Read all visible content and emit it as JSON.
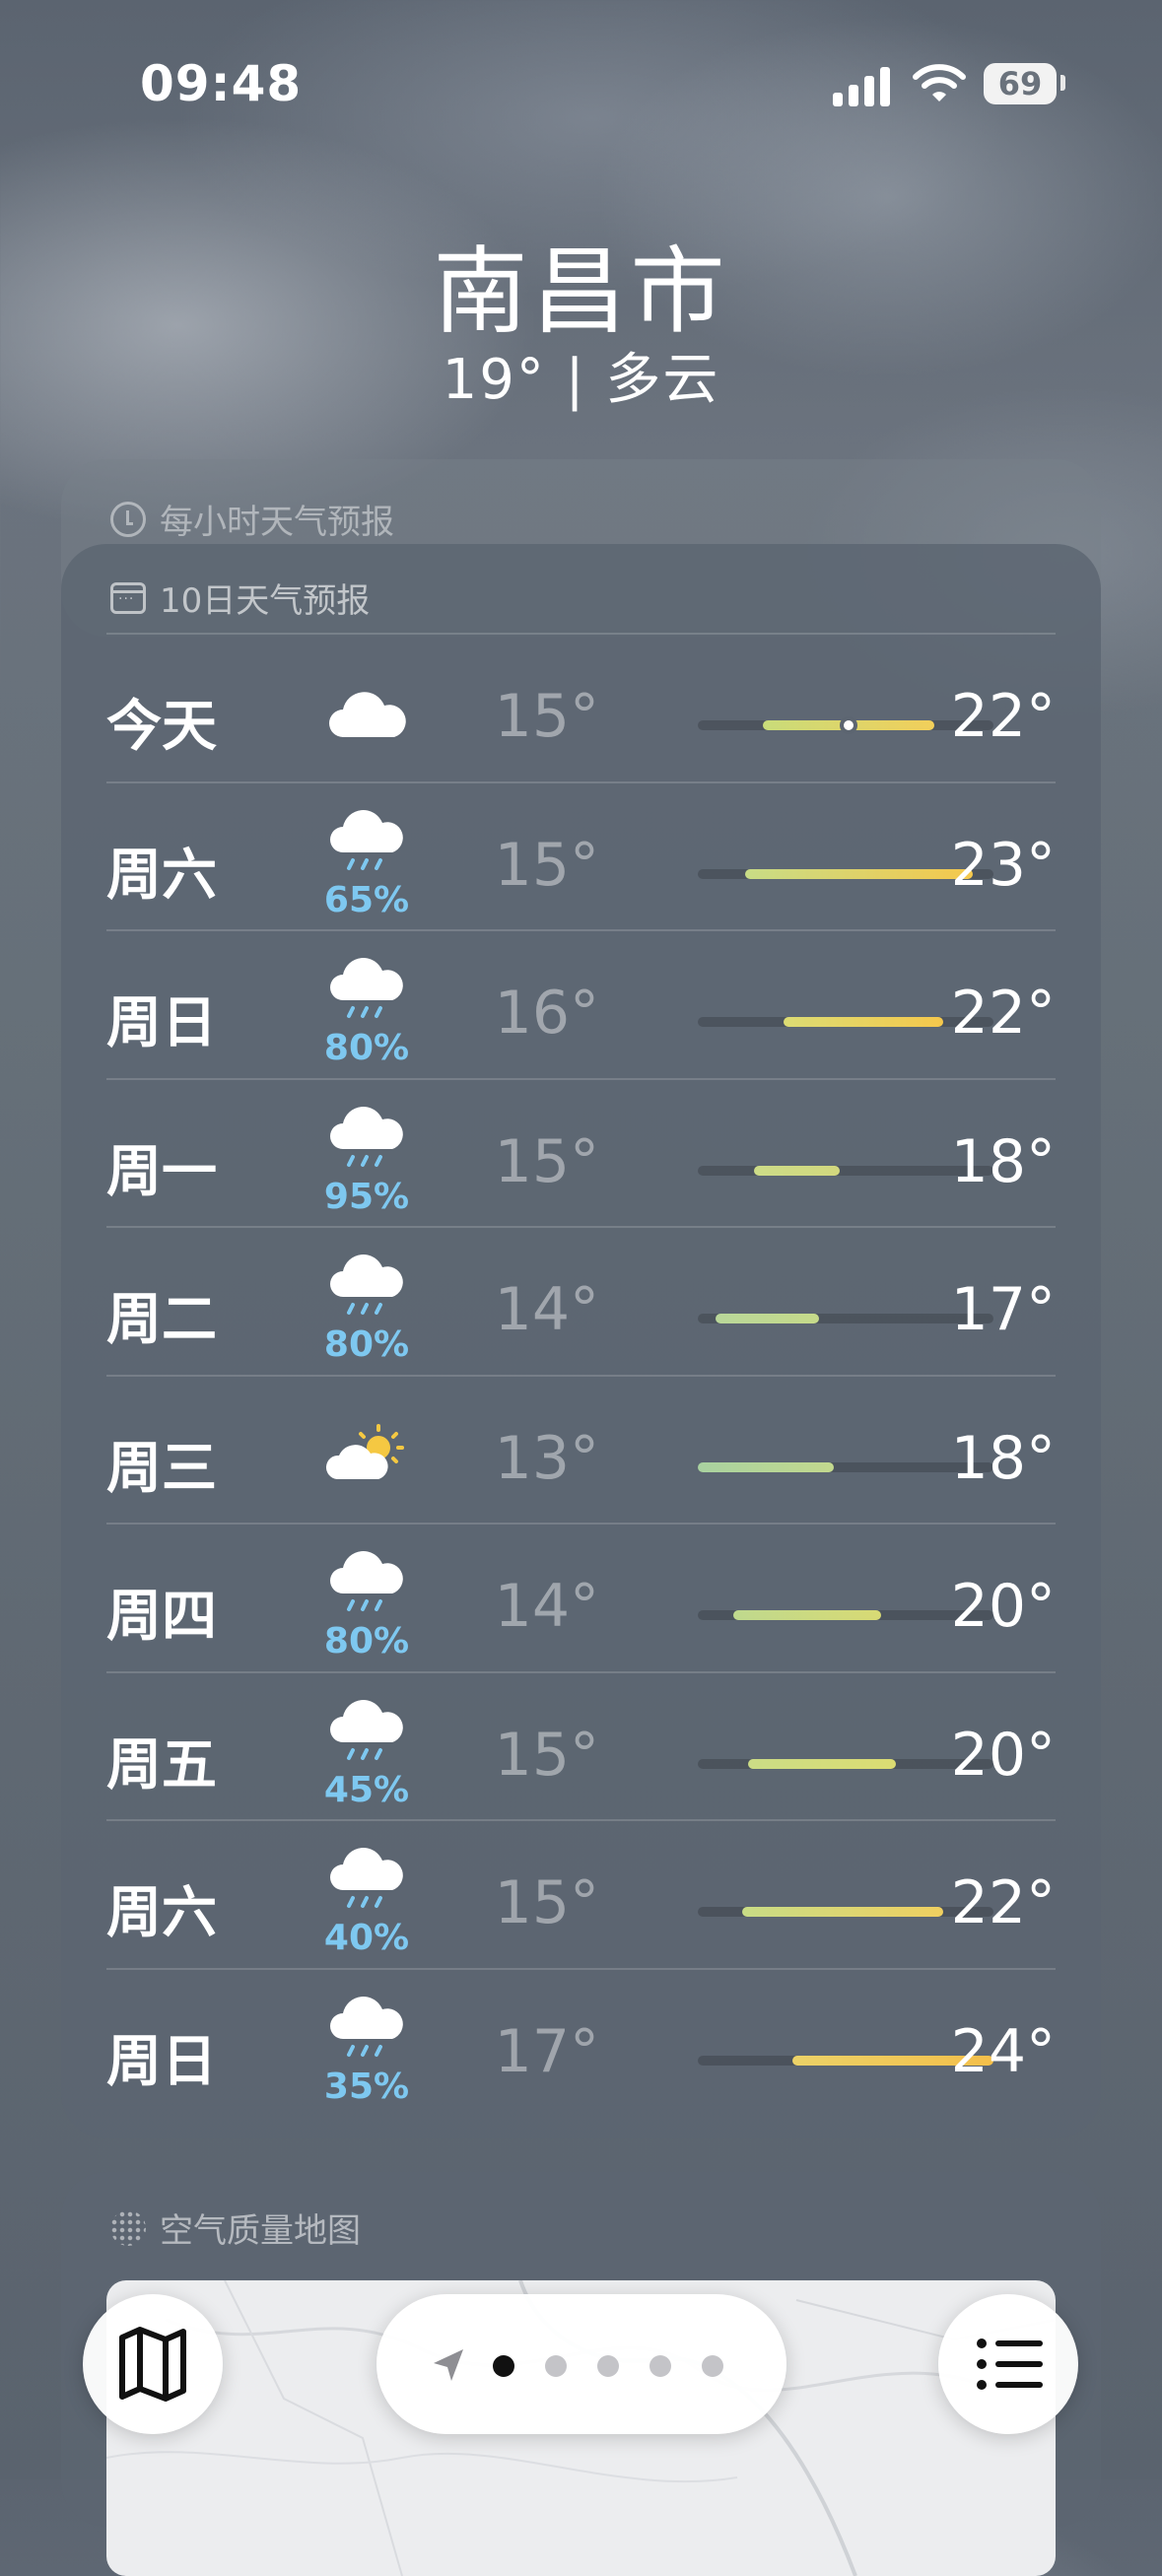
{
  "status_bar": {
    "time": "09:48",
    "battery": "69"
  },
  "location": {
    "city": "南昌市",
    "summary": "19° | 多云"
  },
  "hourly_card": {
    "title": "每小时天气预报"
  },
  "forecast_card": {
    "title": "10日天气预报",
    "days": [
      {
        "day": "今天",
        "icon": "cloud-icon",
        "precip": "",
        "low": "15°",
        "high": "22°",
        "bar_start": 0.22,
        "bar_end": 0.8,
        "current": 0.51,
        "color_from": "#c9dc7a",
        "color_to": "#f2cf5a"
      },
      {
        "day": "周六",
        "icon": "cloud-rain-icon",
        "precip": "65%",
        "low": "15°",
        "high": "23°",
        "bar_start": 0.16,
        "bar_end": 0.93,
        "current": null,
        "color_from": "#c8dc86",
        "color_to": "#f5c84c"
      },
      {
        "day": "周日",
        "icon": "cloud-rain-icon",
        "precip": "80%",
        "low": "16°",
        "high": "22°",
        "bar_start": 0.29,
        "bar_end": 0.83,
        "current": null,
        "color_from": "#dcdc74",
        "color_to": "#f5c84c"
      },
      {
        "day": "周一",
        "icon": "cloud-rain-icon",
        "precip": "95%",
        "low": "15°",
        "high": "18°",
        "bar_start": 0.19,
        "bar_end": 0.48,
        "current": null,
        "color_from": "#cddc88",
        "color_to": "#d2d87e"
      },
      {
        "day": "周二",
        "icon": "cloud-rain-icon",
        "precip": "80%",
        "low": "14°",
        "high": "17°",
        "bar_start": 0.06,
        "bar_end": 0.41,
        "current": null,
        "color_from": "#b9d79a",
        "color_to": "#c6da8a"
      },
      {
        "day": "周三",
        "icon": "sun-cloud-icon",
        "precip": "",
        "low": "13°",
        "high": "18°",
        "bar_start": 0.0,
        "bar_end": 0.46,
        "current": null,
        "color_from": "#a9d2a0",
        "color_to": "#c3d98e"
      },
      {
        "day": "周四",
        "icon": "cloud-rain-icon",
        "precip": "80%",
        "low": "14°",
        "high": "20°",
        "bar_start": 0.12,
        "bar_end": 0.62,
        "current": null,
        "color_from": "#bfd98e",
        "color_to": "#d8da74"
      },
      {
        "day": "周五",
        "icon": "cloud-rain-icon",
        "precip": "45%",
        "low": "15°",
        "high": "20°",
        "bar_start": 0.17,
        "bar_end": 0.67,
        "current": null,
        "color_from": "#cbdc86",
        "color_to": "#dcdc72"
      },
      {
        "day": "周六",
        "icon": "cloud-rain-icon",
        "precip": "40%",
        "low": "15°",
        "high": "22°",
        "bar_start": 0.15,
        "bar_end": 0.83,
        "current": null,
        "color_from": "#c8dc86",
        "color_to": "#f0d060"
      },
      {
        "day": "周日",
        "icon": "cloud-rain-icon",
        "precip": "35%",
        "low": "17°",
        "high": "24°",
        "bar_start": 0.32,
        "bar_end": 1.0,
        "current": null,
        "color_from": "#ecd268",
        "color_to": "#f4bf4a"
      }
    ]
  },
  "air_card": {
    "title": "空气质量地图"
  },
  "bottom_bar": {
    "map_button": "map-icon",
    "list_button": "list-icon",
    "pages": 5,
    "active_page": 1
  }
}
